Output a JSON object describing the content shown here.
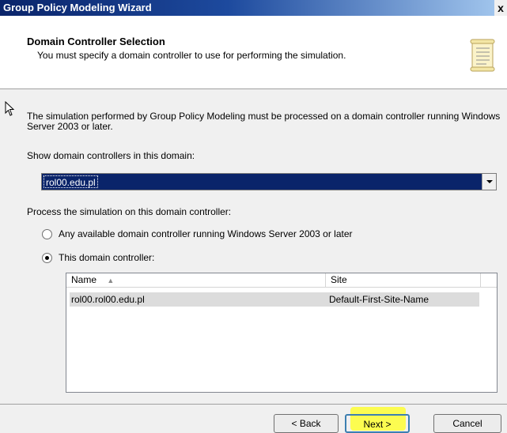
{
  "window": {
    "title": "Group Policy Modeling Wizard",
    "close_glyph": "x"
  },
  "header": {
    "title": "Domain Controller Selection",
    "subtitle": "You must specify a domain controller to use for performing the simulation.",
    "icon": "scroll-icon"
  },
  "intro_text": "The simulation performed by Group Policy Modeling must be processed on a domain controller running Windows Server 2003 or later.",
  "domain_label": "Show domain controllers in this domain:",
  "domain_combo": {
    "selected": "rol00.edu.pl"
  },
  "process_label": "Process the simulation on this domain controller:",
  "radios": [
    {
      "label": "Any available domain controller running Windows Server 2003 or later",
      "checked": false
    },
    {
      "label": "This domain controller:",
      "checked": true
    }
  ],
  "table": {
    "columns": [
      "Name",
      "Site"
    ],
    "rows": [
      {
        "name": "rol00.rol00.edu.pl",
        "site": "Default-First-Site-Name"
      }
    ]
  },
  "buttons": {
    "back": "< Back",
    "next": "Next >",
    "cancel": "Cancel"
  },
  "colors": {
    "title_bar": "#0a246a",
    "selection": "#0a246a",
    "highlight": "#ffff28"
  }
}
